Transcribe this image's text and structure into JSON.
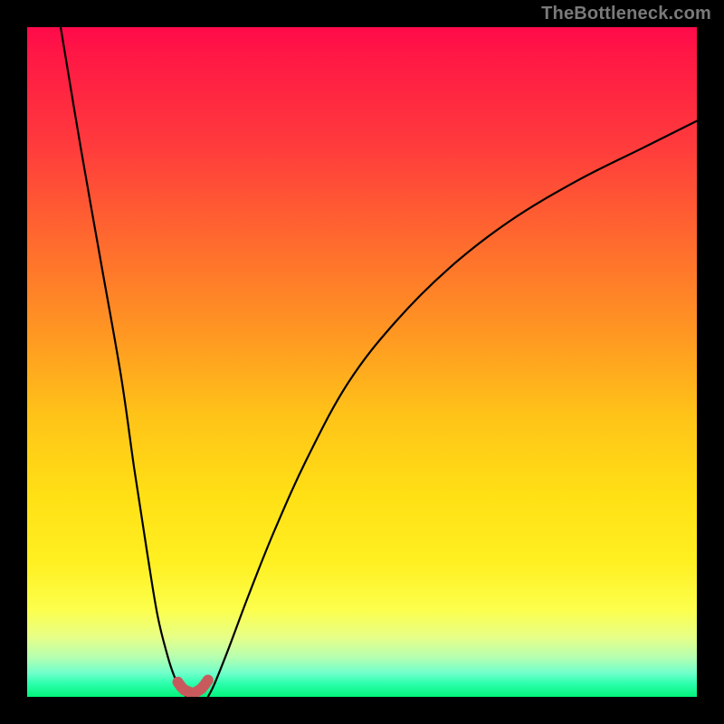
{
  "watermark": {
    "text": "TheBottleneck.com"
  },
  "colors": {
    "page_bg": "#000000",
    "curve_stroke": "#000000",
    "marker_stroke": "#c85a5e",
    "watermark": "#7a7a7a"
  },
  "chart_data": {
    "type": "line",
    "title": "",
    "xlabel": "",
    "ylabel": "",
    "xlim": [
      0,
      100
    ],
    "ylim": [
      0,
      100
    ],
    "series": [
      {
        "name": "left-branch",
        "x": [
          5,
          8,
          11,
          14,
          16,
          18,
          19.5,
          21,
          22,
          23,
          23.8
        ],
        "values": [
          100,
          82,
          65,
          48,
          34,
          21,
          12,
          6,
          3,
          1,
          0
        ]
      },
      {
        "name": "right-branch",
        "x": [
          27,
          28,
          30,
          33,
          37,
          42,
          48,
          55,
          63,
          72,
          82,
          92,
          100
        ],
        "values": [
          0,
          2,
          7,
          15,
          25,
          36,
          47,
          56,
          64,
          71,
          77,
          82,
          86
        ]
      },
      {
        "name": "markers-near-minimum",
        "x": [
          22.5,
          23,
          23.5,
          24.5,
          25,
          26,
          26.5,
          27
        ],
        "values": [
          2.2,
          1.5,
          1.0,
          0.6,
          0.6,
          1.2,
          1.8,
          2.5
        ]
      }
    ],
    "optimum_x": 25
  }
}
